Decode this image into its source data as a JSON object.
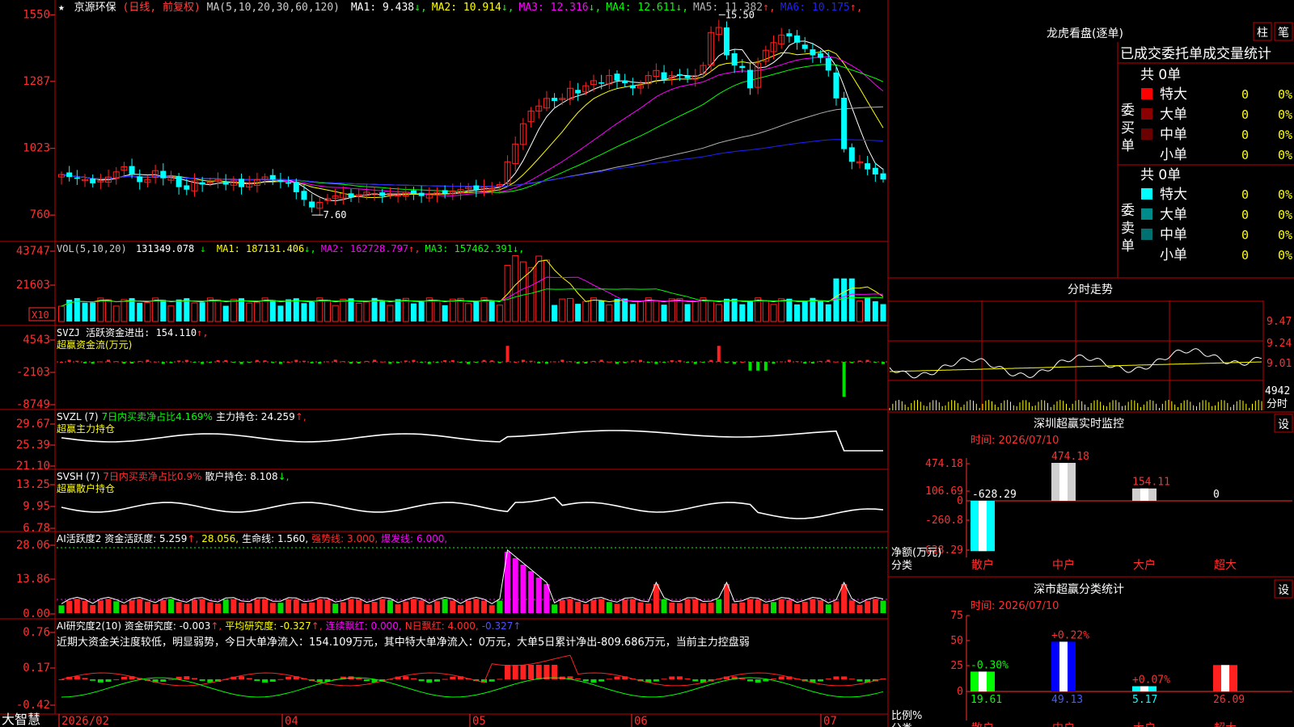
{
  "stock": {
    "star": "★",
    "name": "京源环保",
    "mode": "(日线, 前复权)"
  },
  "colors": {
    "up": "#ff2020",
    "down": "#00ffff",
    "ma5": "#ffffff",
    "ma10": "#ffff00",
    "ma20": "#ff00ff",
    "ma30": "#00ff00",
    "ma60": "#b0b0b0",
    "ma120": "#2020ff",
    "grid": "#c00000",
    "axis": "#ff3030",
    "green_bar": "#00e000",
    "magenta": "#ff00ff"
  },
  "price_panel": {
    "ma_header": "MA(5,10,20,30,60,120)",
    "ma_values": [
      {
        "label": "MA1:",
        "value": "9.438",
        "arrow": "↓",
        "color": "#ffffff"
      },
      {
        "label": "MA2:",
        "value": "10.914",
        "arrow": "↓",
        "color": "#ffff00"
      },
      {
        "label": "MA3:",
        "value": "12.316",
        "arrow": "↓",
        "color": "#ff00ff"
      },
      {
        "label": "MA4:",
        "value": "12.611",
        "arrow": "↓",
        "color": "#00ff00"
      },
      {
        "label": "MA5:",
        "value": "11.382",
        "arrow": "↑",
        "color": "#b0b0b0"
      },
      {
        "label": "MA6:",
        "value": "10.175",
        "arrow": "↑",
        "color": "#2020ff"
      }
    ],
    "y_ticks": [
      "1550",
      "1287",
      "1023",
      "760"
    ],
    "high_label": "15.50",
    "low_label": "7.60"
  },
  "vol_panel": {
    "header": "VOL(5,10,20)",
    "value": "131349.078",
    "value_arrow": "↓",
    "mas": [
      {
        "label": "MA1:",
        "value": "187131.406",
        "arrow": "↓",
        "color": "#ffff00"
      },
      {
        "label": "MA2:",
        "value": "162728.797",
        "arrow": "↑",
        "color": "#ff00ff"
      },
      {
        "label": "MA3:",
        "value": "157462.391",
        "arrow": "↓",
        "color": "#00ff00"
      }
    ],
    "y_ticks": [
      "43747",
      "21603"
    ],
    "unit_badge": "X10"
  },
  "svzj_panel": {
    "line1": "SVZJ  活跃资金进出: 154.110",
    "line1_arrow": "↑,",
    "line2": "超赢资金流(万元)",
    "y_ticks": [
      "4543",
      "-2103",
      "-8749"
    ]
  },
  "svzl_panel": {
    "prefix": "SVZL (7)",
    "seg_a": "7日内买卖净占比4.169%",
    "seg_b": "主力持仓: 24.259",
    "seg_b_arrow": "↑,",
    "line2": "超赢主力持仓",
    "y_ticks": [
      "29.67",
      "25.39",
      "21.10"
    ]
  },
  "svsh_panel": {
    "prefix": "SVSH (7)",
    "seg_a": "7日内买卖净占比0.9%",
    "seg_b": "散户持仓: 8.108",
    "seg_b_arrow": "↓,",
    "line2": "超赢散户持仓",
    "y_ticks": [
      "13.25",
      "9.95",
      "6.78"
    ]
  },
  "ai_activity_panel": {
    "prefix": "AI活跃度2 资金活跃度: 5.259",
    "prefix_arrow": "↑,",
    "v2": "28.056,",
    "v3": "生命线: 1.560,",
    "v4": "强势线: 3.000,",
    "v5": "爆发线: 6.000,",
    "y_ticks": [
      "28.06",
      "13.86",
      "0.00"
    ]
  },
  "ai_research_panel": {
    "prefix": "AI研究度2(10) 资金研究度: -0.003",
    "prefix_arrow": "↑,",
    "v2": "平均研究度: -0.327",
    "v2_arrow": "↑,",
    "v3": "连续飘红: 0.000,",
    "v4": "N日飘红: 4.000,",
    "v5": "-0.327",
    "v5_arrow": "↑",
    "comment": "近期大资金关注度较低，明显弱势，今日大单净流入：154.109万元，其中特大单净流入：0万元，大单5日累计净出-809.686万元，当前主力控盘弱",
    "y_ticks": [
      "0.76",
      "0.17",
      "-0.42"
    ]
  },
  "x_axis": {
    "logo": "大智慧",
    "labels": [
      "2026/02",
      "04",
      "05",
      "06",
      "07"
    ]
  },
  "dragon_tiger": {
    "title": "龙虎看盘(逐单)",
    "btn1": "柱",
    "btn2": "笔",
    "subtitle": "已成交委托单成交量统计",
    "buy": {
      "side_label": "委买单",
      "total": "共 0单",
      "rows": [
        {
          "label": "特大",
          "count": "0",
          "pct": "0%",
          "color": "#ff0000"
        },
        {
          "label": "大单",
          "count": "0",
          "pct": "0%",
          "color": "#8b0000"
        },
        {
          "label": "中单",
          "count": "0",
          "pct": "0%",
          "color": "#6a0000"
        },
        {
          "label": "小单",
          "count": "0",
          "pct": "0%",
          "color": ""
        }
      ]
    },
    "sell": {
      "side_label": "委卖单",
      "total": "共 0单",
      "rows": [
        {
          "label": "特大",
          "count": "0",
          "pct": "0%",
          "color": "#00ffff"
        },
        {
          "label": "大单",
          "count": "0",
          "pct": "0%",
          "color": "#008b8b"
        },
        {
          "label": "中单",
          "count": "0",
          "pct": "0%",
          "color": "#007070"
        },
        {
          "label": "小单",
          "count": "0",
          "pct": "0%",
          "color": ""
        }
      ]
    }
  },
  "intraday": {
    "title": "分时走势",
    "y_ticks": [
      "9.47",
      "9.24",
      "9.01"
    ],
    "volume_label": "4942",
    "volume_unit": "分时"
  },
  "sz_monitor": {
    "title": "深圳超赢实时监控",
    "btn": "设",
    "date_label": "时间: 2026/07/10",
    "y_ticks": [
      "474.18",
      "106.69",
      "0",
      "-260.8",
      "-628.29"
    ],
    "y_title": "净额(万元)",
    "x_title": "分类",
    "categories": [
      "散户",
      "中户",
      "大户",
      "超大"
    ],
    "values": [
      -628.29,
      474.18,
      154.11,
      0
    ],
    "value_labels": [
      "-628.29",
      "474.18",
      "154.11",
      "0"
    ]
  },
  "sz_classify": {
    "title": "深市超赢分类统计",
    "btn": "设",
    "date_label": "时间: 2026/07/10",
    "y_ticks": [
      "75",
      "50",
      "25",
      "0"
    ],
    "y_title": "比例%",
    "x_title": "分类",
    "categories": [
      "散户",
      "中户",
      "大户",
      "超大"
    ],
    "values": [
      19.61,
      49.13,
      5.17,
      26.09
    ],
    "change_labels": [
      "-0.30%",
      "+0.22%",
      "+0.07%",
      ""
    ]
  },
  "chart_data": {
    "type": "candlestick",
    "title": "京源环保 (日线, 前复权)",
    "x_labels": [
      "2026/02",
      "04",
      "05",
      "06",
      "07"
    ],
    "ylim": [
      7.0,
      15.7
    ],
    "close": [
      9.2,
      9.1,
      9.05,
      9.0,
      8.85,
      8.95,
      9.1,
      9.3,
      9.5,
      9.2,
      8.9,
      9.0,
      9.35,
      9.05,
      9.1,
      8.7,
      8.6,
      8.95,
      8.8,
      8.9,
      9.0,
      8.8,
      8.95,
      8.7,
      8.85,
      9.0,
      9.1,
      9.0,
      8.95,
      8.85,
      8.5,
      8.2,
      7.9,
      8.1,
      8.25,
      8.35,
      8.45,
      8.3,
      8.4,
      8.5,
      8.45,
      8.35,
      8.45,
      8.4,
      8.5,
      8.45,
      8.35,
      8.4,
      8.5,
      8.45,
      8.55,
      8.6,
      8.7,
      8.6,
      8.7,
      8.65,
      8.8,
      9.7,
      10.4,
      11.2,
      11.7,
      11.9,
      12.2,
      12.1,
      12.2,
      12.6,
      12.4,
      12.7,
      12.9,
      12.8,
      13.1,
      12.9,
      12.8,
      12.6,
      12.7,
      13.1,
      13.3,
      12.95,
      13.1,
      13.15,
      13.0,
      13.1,
      13.5,
      14.8,
      15.0,
      13.9,
      13.5,
      13.4,
      12.6,
      13.6,
      14.1,
      14.4,
      14.7,
      14.65,
      14.4,
      14.15,
      13.9,
      13.8,
      13.3,
      12.2,
      10.2,
      9.7,
      9.7,
      9.4,
      9.2,
      9.0
    ]
  }
}
